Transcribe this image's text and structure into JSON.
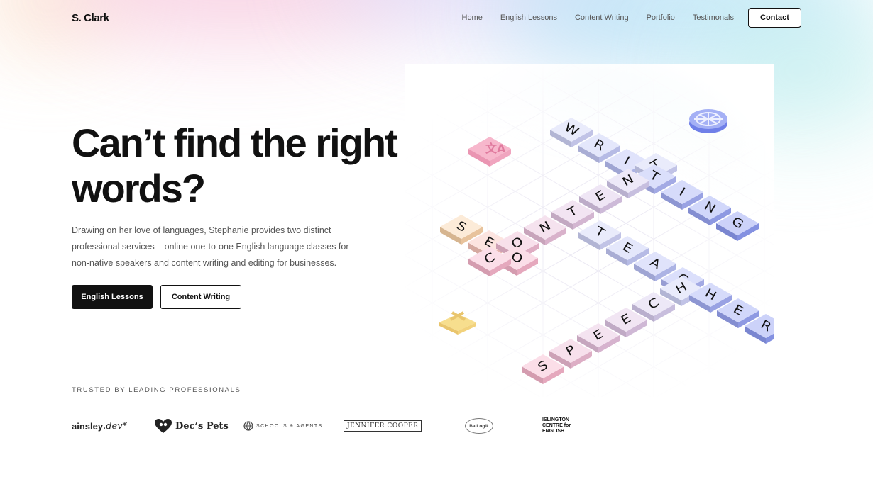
{
  "brand": "S. Clark",
  "nav": {
    "links": [
      "Home",
      "English Lessons",
      "Content Writing",
      "Portfolio",
      "Testimonals"
    ],
    "contact": "Contact"
  },
  "hero": {
    "title": "Can’t find the right words?",
    "description": "Drawing on her love of languages, Stephanie provides two distinct professional services – online one-to-one English language classes for non-native speakers and content writing and editing for businesses.",
    "primary_button": "English Lessons",
    "secondary_button": "Content Writing"
  },
  "trusted": {
    "heading": "TRUSTED BY LEADING PROFESSIONALS",
    "logos": {
      "ainsley_a": "ainsley",
      "ainsley_b": ".dev*",
      "decs": "Dec’s Pets",
      "schools": "SCHOOLS & AGENTS",
      "jennifer": "JENNIFER COOPER",
      "bailogik": "BaiLogik",
      "islington": [
        "ISLINGTON",
        "CENTRE for",
        "ENGLISH"
      ]
    }
  },
  "illustration": {
    "words": [
      "WRITING",
      "CONTENT",
      "TEACHER",
      "SPEECH",
      "SEO"
    ],
    "colors": {
      "pink": "#f6b5cb",
      "peach": "#f9d2a8",
      "lavender": "#cfd2f7",
      "blue": "#8e9cf2",
      "yellow": "#f7de8e"
    }
  }
}
